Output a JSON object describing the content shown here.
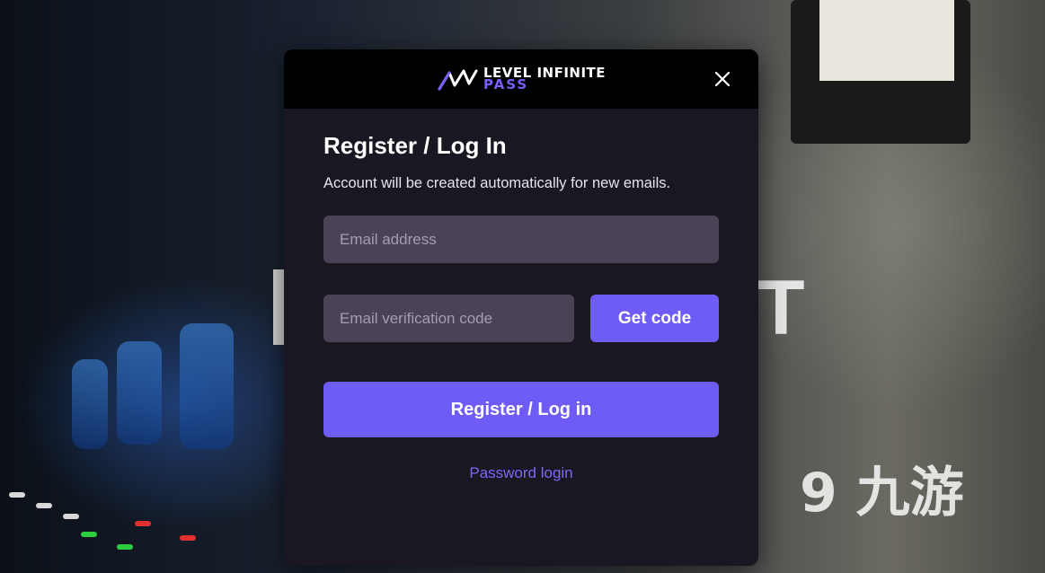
{
  "background": {
    "right_letter": "T",
    "watermark": "9 九游"
  },
  "modal": {
    "brand_line1": "LEVEL INFINITE",
    "brand_line2": "PASS",
    "close_icon": "close-icon",
    "title": "Register / Log In",
    "subtitle": "Account will be created automatically for new emails.",
    "email": {
      "placeholder": "Email address",
      "value": ""
    },
    "code": {
      "placeholder": "Email verification code",
      "value": ""
    },
    "get_code_label": "Get code",
    "submit_label": "Register / Log in",
    "password_login_label": "Password login"
  },
  "colors": {
    "accent": "#6e5cf6",
    "modal_bg": "#1b1722",
    "input_bg": "#4a4356",
    "link": "#7c68f5"
  }
}
